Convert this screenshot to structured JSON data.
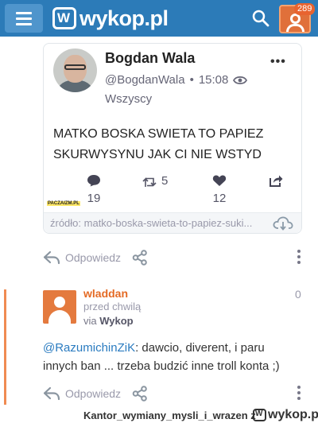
{
  "header": {
    "logo_text": "wykop.pl",
    "notifications_count": "289"
  },
  "tweet": {
    "name": "Bogdan Wala",
    "handle": "@BogdanWala",
    "time": "15:08",
    "audience": "Wszyscy",
    "text": "MATKO BOSKA SWIETA TO PAPIEZ SKURWYSYNU JAK CI NIE WSTYD",
    "replies": "19",
    "retweets": "5",
    "likes": "12",
    "watermark": "PACZAIZM.PL",
    "source": "źródło: matko-boska-swieta-to-papiez-suki..."
  },
  "post_actions": {
    "reply_label": "Odpowiedz"
  },
  "comment": {
    "username": "wladdan",
    "time": "przed chwilą",
    "via_prefix": "via",
    "via_app": "Wykop",
    "votes": "0",
    "mention": "@RazumichinZiK",
    "text": ": dawcio, diverent, i paru innych ban ... trzeba budzić inne troll konta ;)",
    "reply_label": "Odpowiedz"
  },
  "footer": {
    "username": "Kantor_wymiany_mysli_i_wrazen",
    "suffix": "z",
    "logo_text": "wykop.pl"
  },
  "colors": {
    "header_blue": "#2c7bb8",
    "accent_orange": "#e46a24",
    "link_blue": "#2a7bc0"
  }
}
